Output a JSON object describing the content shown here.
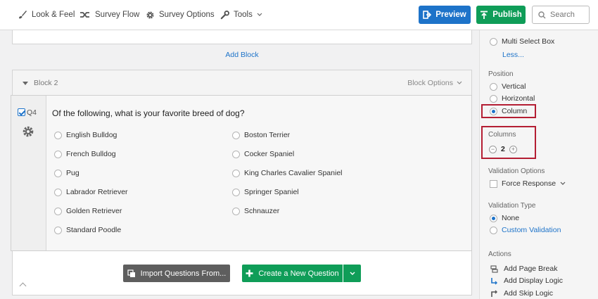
{
  "toolbar": {
    "look_feel": "Look & Feel",
    "survey_flow": "Survey Flow",
    "survey_options": "Survey Options",
    "tools": "Tools",
    "preview": "Preview",
    "publish": "Publish",
    "search_placeholder": "Search"
  },
  "canvas": {
    "add_block": "Add Block",
    "block_title": "Block 2",
    "block_options": "Block Options"
  },
  "question": {
    "number": "Q4",
    "text": "Of the following, what is your favorite breed of dog?",
    "choices_col1": [
      "English Bulldog",
      "French Bulldog",
      "Pug",
      "Labrador Retriever",
      "Golden Retriever",
      "Standard Poodle"
    ],
    "choices_col2": [
      "Boston Terrier",
      "Cocker Spaniel",
      "King Charles Cavalier Spaniel",
      "Springer Spaniel",
      "Schnauzer"
    ]
  },
  "footer": {
    "import": "Import Questions From...",
    "create": "Create a New Question"
  },
  "panel": {
    "multi_select_box": "Multi Select Box",
    "less": "Less...",
    "position_label": "Position",
    "position_options": [
      "Vertical",
      "Horizontal",
      "Column"
    ],
    "position_selected": "Column",
    "columns_label": "Columns",
    "columns_value": "2",
    "validation_options_label": "Validation Options",
    "force_response": "Force Response",
    "validation_type_label": "Validation Type",
    "validation_none": "None",
    "custom_validation": "Custom Validation",
    "actions_label": "Actions",
    "actions": [
      "Add Page Break",
      "Add Display Logic",
      "Add Skip Logic"
    ]
  },
  "colors": {
    "accent_blue": "#1d73c9",
    "publish_green": "#0f9d58",
    "highlight_red": "#b41e33"
  }
}
